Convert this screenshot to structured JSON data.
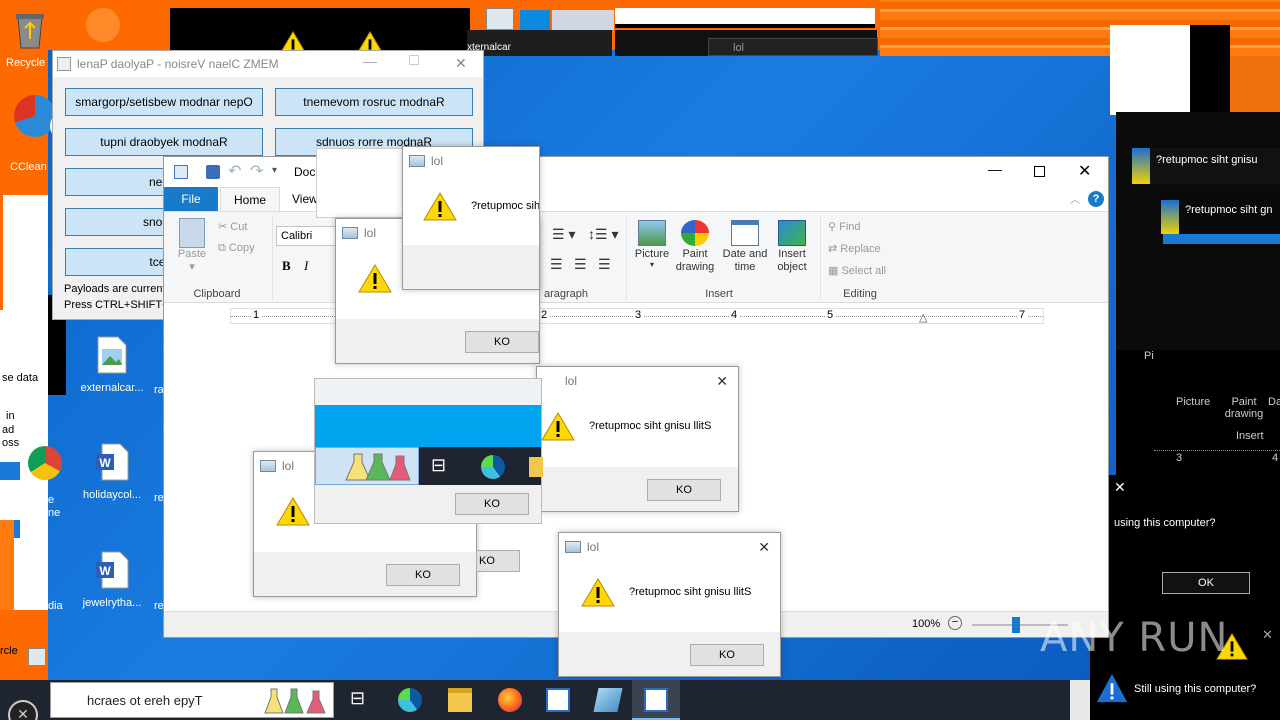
{
  "desktop": {
    "icons": [
      {
        "label": "Recycle",
        "kind": "recycle"
      },
      {
        "label": "CClean",
        "kind": "ccleaner"
      },
      {
        "label": "externalcar...",
        "kind": "image"
      },
      {
        "label": "holidaycol...",
        "kind": "word"
      },
      {
        "label": "jewelrytha...",
        "kind": "word"
      },
      {
        "label": "rcle",
        "kind": "recycle"
      }
    ],
    "fragments": [
      "se data",
      "in",
      "ad",
      "oss",
      "e",
      "ne",
      "dia",
      "r",
      "x",
      "ra",
      "re",
      "re",
      "re",
      "xternalcar",
      "lol"
    ]
  },
  "panel": {
    "title": "lenaP daolyaP - noisreV naelC ZMEM",
    "buttons": [
      "smargorp/setisbew modnar nepO",
      "tnemevom rosruc modnaR",
      "tupni draobyek modnaR",
      "sdnuos rorre modnaR",
      "neerc",
      "snoci ro",
      "tceffe"
    ],
    "notes": [
      "Payloads are current",
      "Press CTRL+SHIFT+"
    ]
  },
  "wordpad": {
    "title": "Doc",
    "tabs": {
      "file": "File",
      "home": "Home",
      "view": "View"
    },
    "clipboard": {
      "paste": "Paste",
      "cut": "Cut",
      "copy": "Copy",
      "group": "Clipboard"
    },
    "font": {
      "name": "Calibri",
      "bold": "B",
      "italic": "I"
    },
    "paragraph": {
      "group": "aragraph"
    },
    "insert": {
      "picture": "Picture",
      "paint": "Paint drawing",
      "datetime": "Date and time",
      "object": "Insert object",
      "group": "Insert"
    },
    "editing": {
      "find": "Find",
      "replace": "Replace",
      "selectall": "Select all",
      "group": "Editing"
    },
    "ruler": [
      "1",
      "2",
      "3",
      "4",
      "5",
      "7"
    ],
    "zoom": "100%"
  },
  "dialogs": [
    {
      "title": "lol",
      "message": "?retupmoc siht",
      "ok": "KO"
    },
    {
      "title": "lol",
      "message": "?",
      "ok": "KO"
    },
    {
      "title": "lol",
      "message": "?retupmoc siht gnisu llitS",
      "ok": "KO"
    },
    {
      "title": "lol",
      "message": "?",
      "ok": "KO"
    },
    {
      "title": "lol",
      "message": "?retupmoc siht gnisu llitS",
      "ok": "KO"
    },
    {
      "title": "",
      "message": "",
      "ok": "KO"
    }
  ],
  "right_side": {
    "msg1": "?retupmoc siht gnisu",
    "msg2": "?retupmoc siht gn",
    "ribbon_labels": [
      "Picture",
      "Paint drawing",
      "Da",
      "Insert"
    ],
    "ruler": [
      "3",
      "4"
    ],
    "dialog_text": "using this computer?",
    "ok": "OK",
    "bottom_text": "Still using this computer?",
    "pi_label": "Pi"
  },
  "taskbar": {
    "search_placeholder": "hcraes ot ereh epyT"
  },
  "watermark": "ANY RUN",
  "colors": {
    "accent": "#0078d7",
    "warning": "#ffd800",
    "panel_btn": "#cce4f7"
  }
}
